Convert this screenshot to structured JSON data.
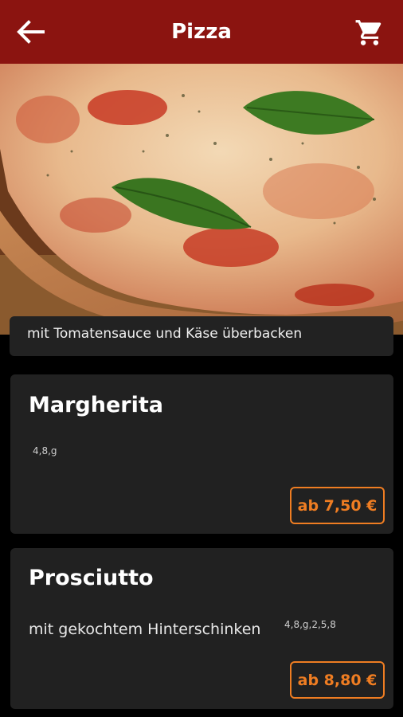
{
  "header": {
    "title": "Pizza",
    "back_icon": "arrow-left-icon",
    "cart_icon": "shopping-cart-icon",
    "bg_color": "#8b1410"
  },
  "category": {
    "description": "mit Tomatensauce und Käse überbacken"
  },
  "items": [
    {
      "name": "Margherita",
      "description": "",
      "codes": "4,8,g",
      "price_label": "ab 7,50 €"
    },
    {
      "name": "Prosciutto",
      "description": "mit gekochtem Hinterschinken",
      "codes": "4,8,g,2,5,8",
      "price_label": "ab 8,80 €"
    }
  ],
  "accent_color": "#ef7d22"
}
